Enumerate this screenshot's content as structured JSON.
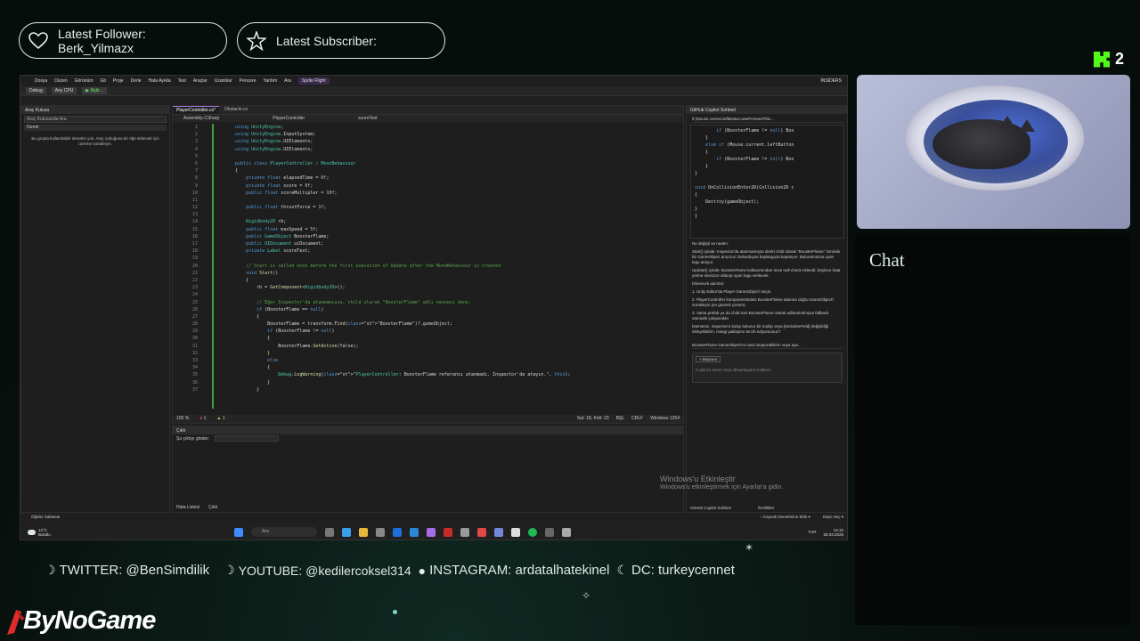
{
  "overlay": {
    "follower_label": "Latest Follower:",
    "follower_name": "Berk_Yilmazx",
    "subscriber_label": "Latest Subscriber:",
    "subscriber_name": "",
    "kick_count": "2",
    "chat_title": "Chat",
    "socials": [
      {
        "icon": "twitter-icon",
        "text": "TWITTER: @BenSimdilik"
      },
      {
        "icon": "youtube-icon",
        "text": "YOUTUBE: @kedilercoksel314"
      },
      {
        "icon": "instagram-icon",
        "text": "INSTAGRAM: ardatalhatekinel"
      },
      {
        "icon": "discord-icon",
        "text": "DC: turkeycennet"
      }
    ],
    "brand": "ByNoGame",
    "accent_color": "#53fc18"
  },
  "vs": {
    "menu": [
      "Dosya",
      "Düzen",
      "Görünüm",
      "Git",
      "Proje",
      "Derle",
      "Hata Ayıkla",
      "Test",
      "Araçlar",
      "Uzantılar",
      "Pencere",
      "Yardım",
      "Ara",
      "Sprite Flight"
    ],
    "insiders": "INSİDERS",
    "toolbar": {
      "config": "Debug",
      "cpu": "Any CPU",
      "run": "▶ İliştir..."
    },
    "toolbox": {
      "title": "Araç Kutusu",
      "search": "Araç Kutusunda Ara",
      "group": "Genel",
      "message": "Bu grupta kullanılabilir denetim yok. Araç çubuğuna bir öğe eklemek için üzerine sürükleyin."
    },
    "editor": {
      "tabs": [
        "PlayerController.cs*",
        "Obstacle.cs"
      ],
      "nav": [
        "Assembly-CSharp",
        "PlayerController",
        "scoreText"
      ],
      "status_zoom": "100 %",
      "status_errors": "1",
      "status_warnings": "1",
      "status_pos": "Sat: 18, Krkt: 23",
      "status_ins": "BŞL",
      "status_eol": "CRLF",
      "status_enc": "Windows 1254"
    },
    "output": {
      "title": "Çıktı",
      "show_from": "Şu çıktıyı göster:",
      "tabs": [
        "Hata Listesi",
        "Çıktı"
      ]
    },
    "copilot": {
      "title": "GitHub Copilot Sohbeti",
      "ref_line": "if (Mouse.current.leftButton.wasPressedThis...",
      "changes_title": "Ne değişti ve neden:",
      "bullet1": "Start() içinde: Inspector'da atanmamışsa direkt child olarak \"BoosterFlame\" isminde bir GameObject arıyoruz; bulunduysa başlangıçta kapatıyor. Bulunamazsa uyarı logu atılıyor.",
      "bullet2": "Update() içinde: BoosterFlame kullanımından önce null-check eklendi, böylece hata yerine sessizce atlanıp uyarı logu verilecek.",
      "steps_title": "İzlenecek adımlar:",
      "step1": "1. Unity Editor'da Player GameObject'i seçin.",
      "step2": "2. PlayerController komponentindeki BoosterFlame alanına doğru GameObject'i sürükleyin (en güvenli çözüm).",
      "step3": "3. Varsa prefab ya da child ismi BoosterFlame olarak adlandırılmışsa fallback otomatik çalışacaktır.",
      "closing": "İsterseniz, inspector'a kolay bulunur bir tooltip veya [SerializeField] değişikliği ekleyebilirim. Hangi yaklaşımı tercih ediyorsunuz?",
      "ask": "BoosterFlame GameObject'ini nasıl oluşturabilirim veya aya...",
      "ref_button": "+ Başvuru",
      "placeholder": "Copilot'a sorun veya @workspace kullanın",
      "footer_tabs": [
        "GitHub Copilot Sohbeti",
        "Özellikler"
      ]
    },
    "statusbar": {
      "left": "Öğeler Saklandı",
      "center": "↑ Kaynak Denetimine Ekle ▾",
      "right": "Depo Seç ▾"
    },
    "watermark": {
      "title": "Windows'u Etkinleştir",
      "subtitle": "Windows'u etkinleştirmek için Ayarlar'a gidin."
    }
  },
  "code_lines": [
    {
      "n": "1",
      "t": "    using UnityEngine;"
    },
    {
      "n": "2",
      "t": "    using UnityEngine.InputSystem;"
    },
    {
      "n": "3",
      "t": "    using UnityEngine.UIElements;"
    },
    {
      "n": "4",
      "t": "    using UnityEngine.UIElements;"
    },
    {
      "n": "5",
      "t": ""
    },
    {
      "n": "6",
      "t": "    public class PlayerController : MonoBehaviour"
    },
    {
      "n": "7",
      "t": "    {"
    },
    {
      "n": "8",
      "t": "        private float elapsedTime = 0f;"
    },
    {
      "n": "9",
      "t": "        private float score = 0f;"
    },
    {
      "n": "10",
      "t": "        public float scoreMultipler = 10f;"
    },
    {
      "n": "11",
      "t": ""
    },
    {
      "n": "12",
      "t": "        public float thrustForce = 1f;"
    },
    {
      "n": "13",
      "t": ""
    },
    {
      "n": "14",
      "t": "        Rigidbody2D rb;"
    },
    {
      "n": "15",
      "t": "        public float maxSpeed = 5f;"
    },
    {
      "n": "16",
      "t": "        public GameObject BoosterFlame;"
    },
    {
      "n": "17",
      "t": "        public UIDocument uiDocument;"
    },
    {
      "n": "18",
      "t": "        private Label scoreText;"
    },
    {
      "n": "19",
      "t": ""
    },
    {
      "n": "20",
      "t": "        // Start is called once before the first execution of Update after the MonoBehaviour is created"
    },
    {
      "n": "21",
      "t": "        void Start()"
    },
    {
      "n": "22",
      "t": "        {"
    },
    {
      "n": "23",
      "t": "            rb = GetComponent<Rigidbody2D>();"
    },
    {
      "n": "24",
      "t": ""
    },
    {
      "n": "25",
      "t": "            // Eğer Inspector'da atanmamışsa, child olarak \"BoosterFlame\" adlı nesneyi dene."
    },
    {
      "n": "26",
      "t": "            if (BoosterFlame == null)"
    },
    {
      "n": "27",
      "t": "            {"
    },
    {
      "n": "28",
      "t": "                BoosterFlame = transform.Find(\"BoosterFlame\")?.gameObject;"
    },
    {
      "n": "29",
      "t": "                if (BoosterFlame != null)"
    },
    {
      "n": "30",
      "t": "                {"
    },
    {
      "n": "31",
      "t": "                    BoosterFlame.SetActive(false);"
    },
    {
      "n": "32",
      "t": "                }"
    },
    {
      "n": "33",
      "t": "                else"
    },
    {
      "n": "34",
      "t": "                {"
    },
    {
      "n": "35",
      "t": "                    Debug.LogWarning(\"PlayerController: BoosterFlame referansı atanmadı. Inspector'da atayın.\", this);"
    },
    {
      "n": "36",
      "t": "                }"
    },
    {
      "n": "37",
      "t": "            }"
    }
  ],
  "copilot_code": [
    "        if (BoosterFlame != null) Boo",
    "    }",
    "    else if (Mouse.current.leftButton",
    "    {",
    "        if (BoosterFlame != null) Boo",
    "    }",
    "}",
    "",
    "void OnCollisionEnter2D(Collision2D c",
    "{",
    "    Destroy(gameObject);",
    "}",
    "}"
  ],
  "taskbar": {
    "weather_temp": "12°C",
    "weather_desc": "Bulutlu",
    "search": "Ara",
    "lang": "TUR",
    "time": "14:12",
    "date": "28.03.2026"
  }
}
